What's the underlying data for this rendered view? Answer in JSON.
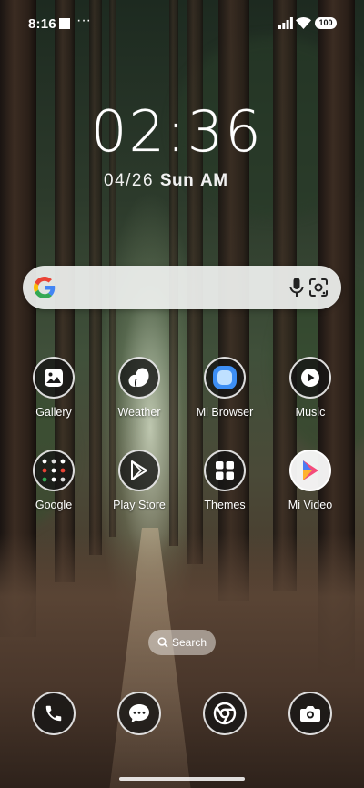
{
  "status": {
    "time": "8:16",
    "more": "···",
    "battery": "100"
  },
  "clock": {
    "time": "02:36",
    "date": "04/26",
    "day": "Sun",
    "ampm": "AM"
  },
  "search_bar": {
    "logo": "google-logo-icon",
    "mic": "mic-icon",
    "lens": "lens-icon"
  },
  "apps": [
    {
      "label": "Gallery",
      "icon": "gallery-icon"
    },
    {
      "label": "Weather",
      "icon": "weather-icon"
    },
    {
      "label": "Mi Browser",
      "icon": "mi-browser-icon"
    },
    {
      "label": "Music",
      "icon": "music-icon"
    },
    {
      "label": "Google",
      "icon": "google-folder-icon"
    },
    {
      "label": "Play Store",
      "icon": "play-store-icon"
    },
    {
      "label": "Themes",
      "icon": "themes-icon"
    },
    {
      "label": "Mi Video",
      "icon": "mi-video-icon"
    }
  ],
  "search_pill": {
    "label": "Search"
  },
  "dock": [
    {
      "icon": "phone-icon"
    },
    {
      "icon": "messages-icon"
    },
    {
      "icon": "chrome-icon"
    },
    {
      "icon": "camera-icon"
    }
  ],
  "colors": {
    "google_blue": "#4285F4",
    "google_red": "#EA4335",
    "google_yellow": "#FBBC05",
    "google_green": "#34A853",
    "mi_browser_blue": "#3d8ff5"
  }
}
